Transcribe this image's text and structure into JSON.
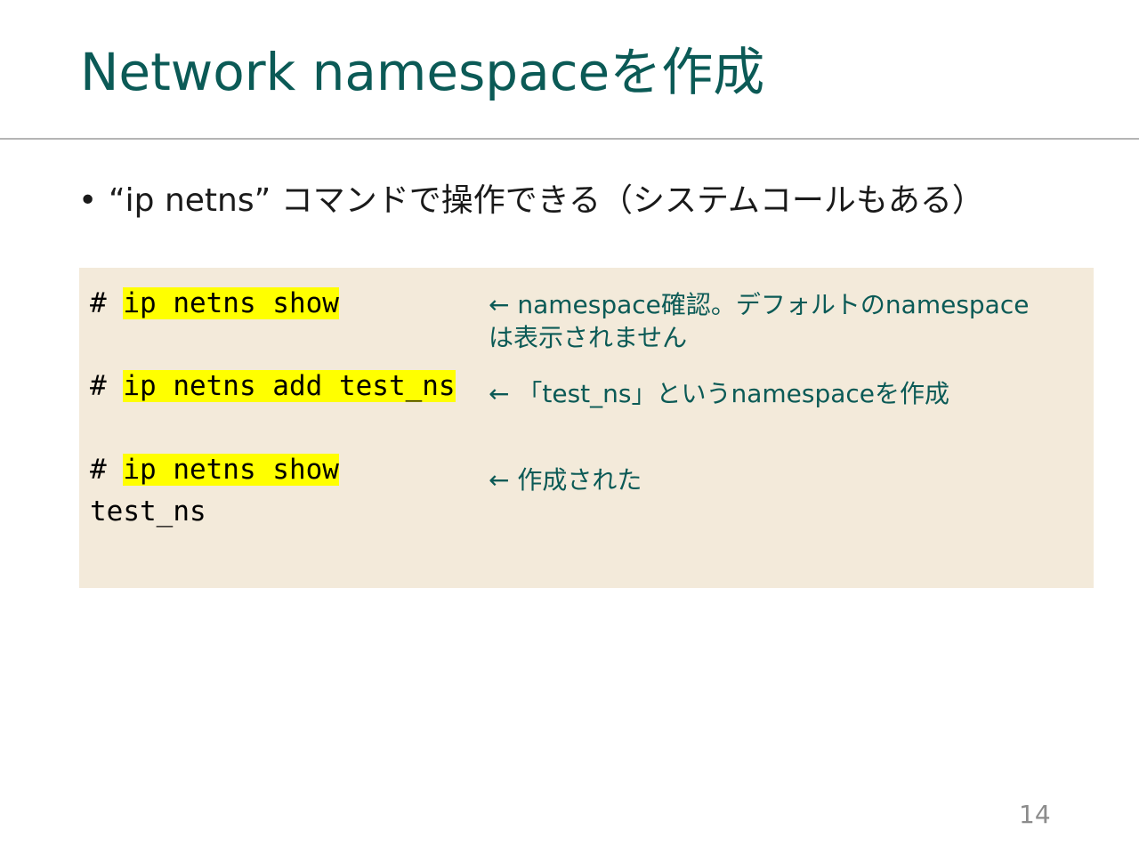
{
  "slide": {
    "title": "Network namespaceを作成",
    "bullet_marker": "•",
    "bullet_text": "“ip netns” コマンドで操作できる（システムコールもある）",
    "page_number": "14"
  },
  "code_block": {
    "prompt": "# ",
    "commands": [
      {
        "command": "ip netns show",
        "note_lines": [
          "← namespace確認。デフォルトのnamespace",
          "は表示されません"
        ]
      },
      {
        "command": "ip netns add test_ns",
        "note_lines": [
          "← 「test_ns」というnamespaceを作成"
        ]
      },
      {
        "command": "ip netns show",
        "output": "test_ns",
        "note_lines": [
          "← 作成された"
        ]
      }
    ]
  },
  "colors": {
    "title": "#0b5a56",
    "annotation": "#0b5a56",
    "highlight": "#ffff00",
    "code_background": "#f3eada",
    "rule": "#b5b5b5"
  }
}
